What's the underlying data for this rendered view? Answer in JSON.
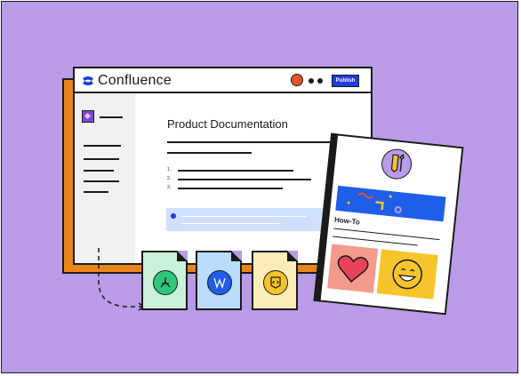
{
  "app": {
    "title": "Confluence",
    "brand_color": "#1f3be0"
  },
  "toolbar": {
    "publish_label": "Publish"
  },
  "page": {
    "title": "Product Documentation",
    "list_numbers": [
      "1.",
      "2.",
      "3."
    ]
  },
  "howto": {
    "label": "How-To"
  },
  "icons": {
    "brand": "confluence-logo-icon",
    "sidebar": "space-icon",
    "file1": "pdf-icon",
    "file2": "word-icon",
    "file3": "code-icon",
    "badge": "tools-icon",
    "heart": "heart-icon",
    "smile": "smile-icon"
  },
  "colors": {
    "background": "#b99be8",
    "book": "#e8861a",
    "publish": "#1f3be0",
    "file_pdf": "#c9f0db",
    "file_word": "#b9dcff",
    "file_code": "#fbedb8"
  }
}
